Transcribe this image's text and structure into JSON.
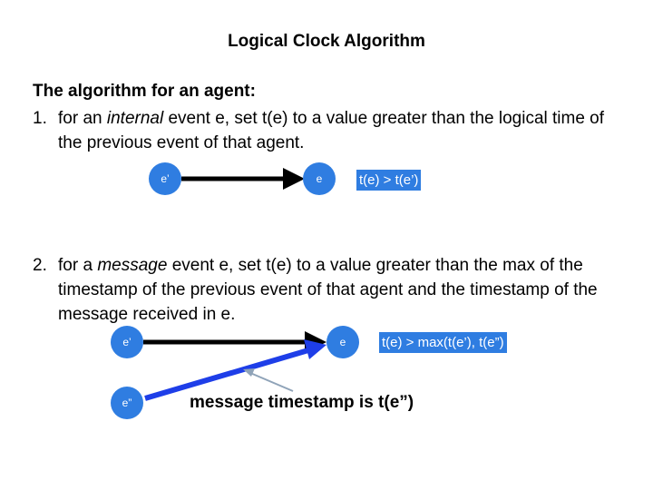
{
  "slide": {
    "title": "Logical Clock Algorithm",
    "heading": "The algorithm for an agent:",
    "rules": [
      {
        "number": "1.",
        "before": "for an ",
        "emphasis": "internal",
        "after": " event e, set t(e) to a value greater than the logical time of the previous event of that agent."
      },
      {
        "number": "2.",
        "before": "for a ",
        "emphasis": "message",
        "after": " event e, set t(e) to a value greater than the max of the timestamp of the previous event of that agent and the timestamp of the message received in e."
      }
    ]
  },
  "diagram1": {
    "from_node": "e’",
    "to_node": "e",
    "formula": "t(e) > t(e’)"
  },
  "diagram2": {
    "prev_node": "e’",
    "event_node": "e",
    "sender_node": "e”",
    "formula": "t(e) > max(t(e’), t(e”)",
    "caption": "message timestamp is t(e”)"
  },
  "colors": {
    "node_fill": "#2f7de1",
    "message_arrow": "#1e3ee8",
    "local_arrow": "#000000",
    "pointer_arrow": "#8fa3b8"
  }
}
